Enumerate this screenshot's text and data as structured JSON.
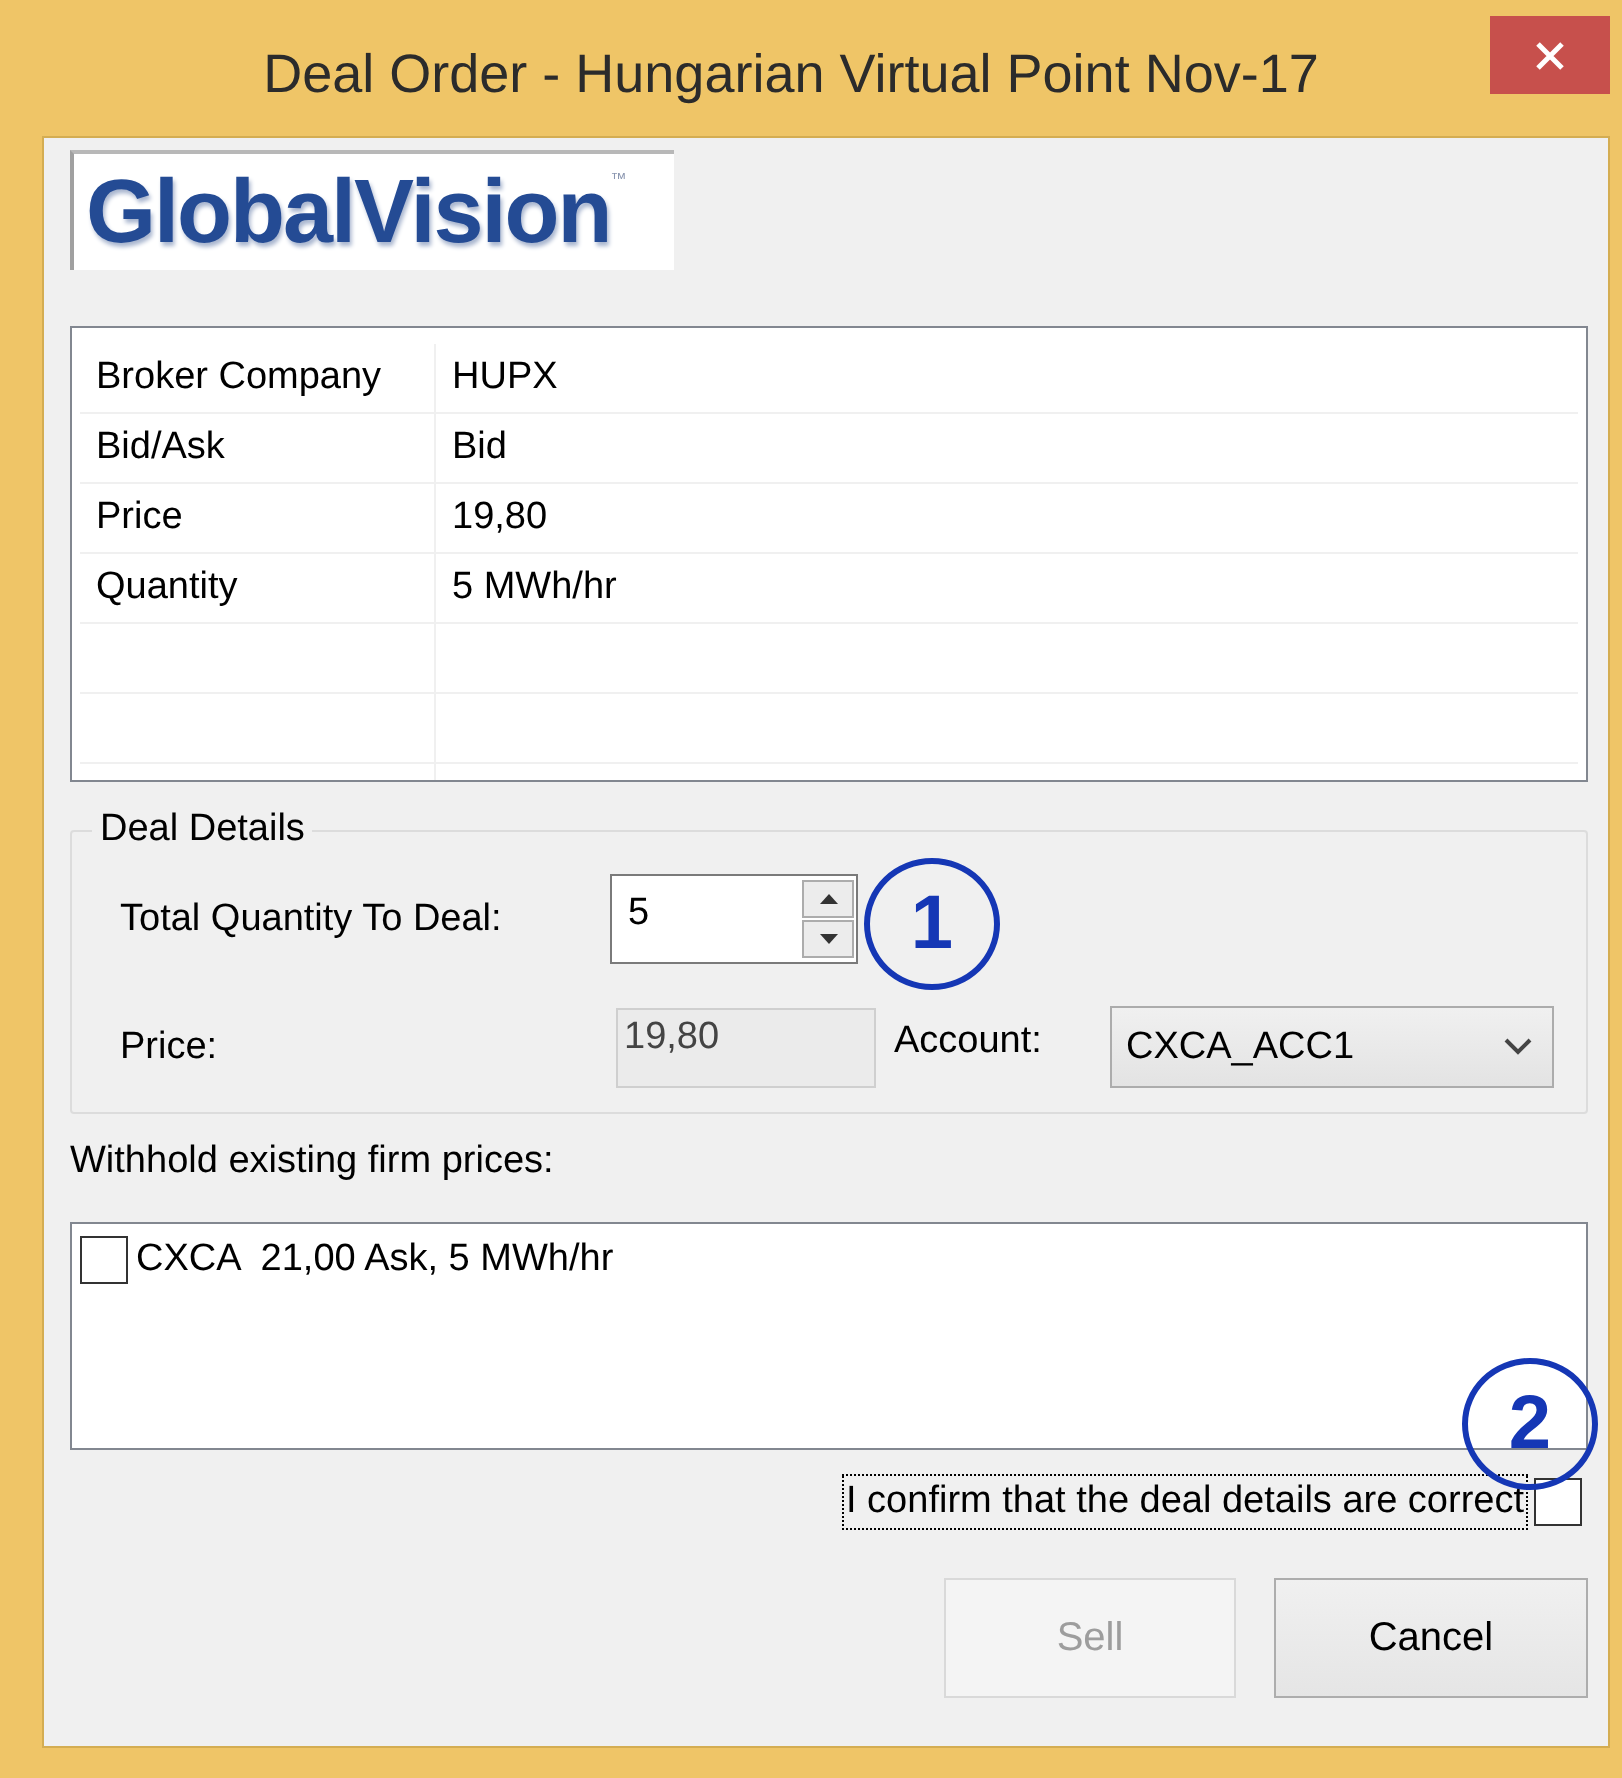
{
  "window": {
    "title": "Deal Order - Hungarian Virtual Point Nov-17"
  },
  "logo": {
    "text": "GlobalVision",
    "mark": "™"
  },
  "summary": {
    "rows": [
      {
        "label": "Broker Company",
        "value": "HUPX"
      },
      {
        "label": "Bid/Ask",
        "value": "Bid"
      },
      {
        "label": "Price",
        "value": "19,80"
      },
      {
        "label": "Quantity",
        "value": "5 MWh/hr"
      }
    ]
  },
  "deal_details": {
    "title": "Deal Details",
    "quantity": {
      "label": "Total Quantity To Deal:",
      "value": "5"
    },
    "price": {
      "label": "Price:",
      "value": "19,80",
      "disabled": true
    },
    "account": {
      "label": "Account:",
      "value": "CXCA_ACC1"
    }
  },
  "withhold": {
    "label": "Withhold existing firm prices:",
    "items": [
      {
        "label": "CXCA  21,00 Ask, 5 MWh/hr",
        "checked": false
      }
    ]
  },
  "confirm": {
    "label": "I confirm that the deal details are correct",
    "checked": false,
    "focused": true
  },
  "buttons": [
    {
      "label": "Sell",
      "disabled": true
    },
    {
      "label": "Cancel",
      "disabled": false
    }
  ],
  "annotations": [
    {
      "label": "1"
    },
    {
      "label": "2"
    }
  ]
}
